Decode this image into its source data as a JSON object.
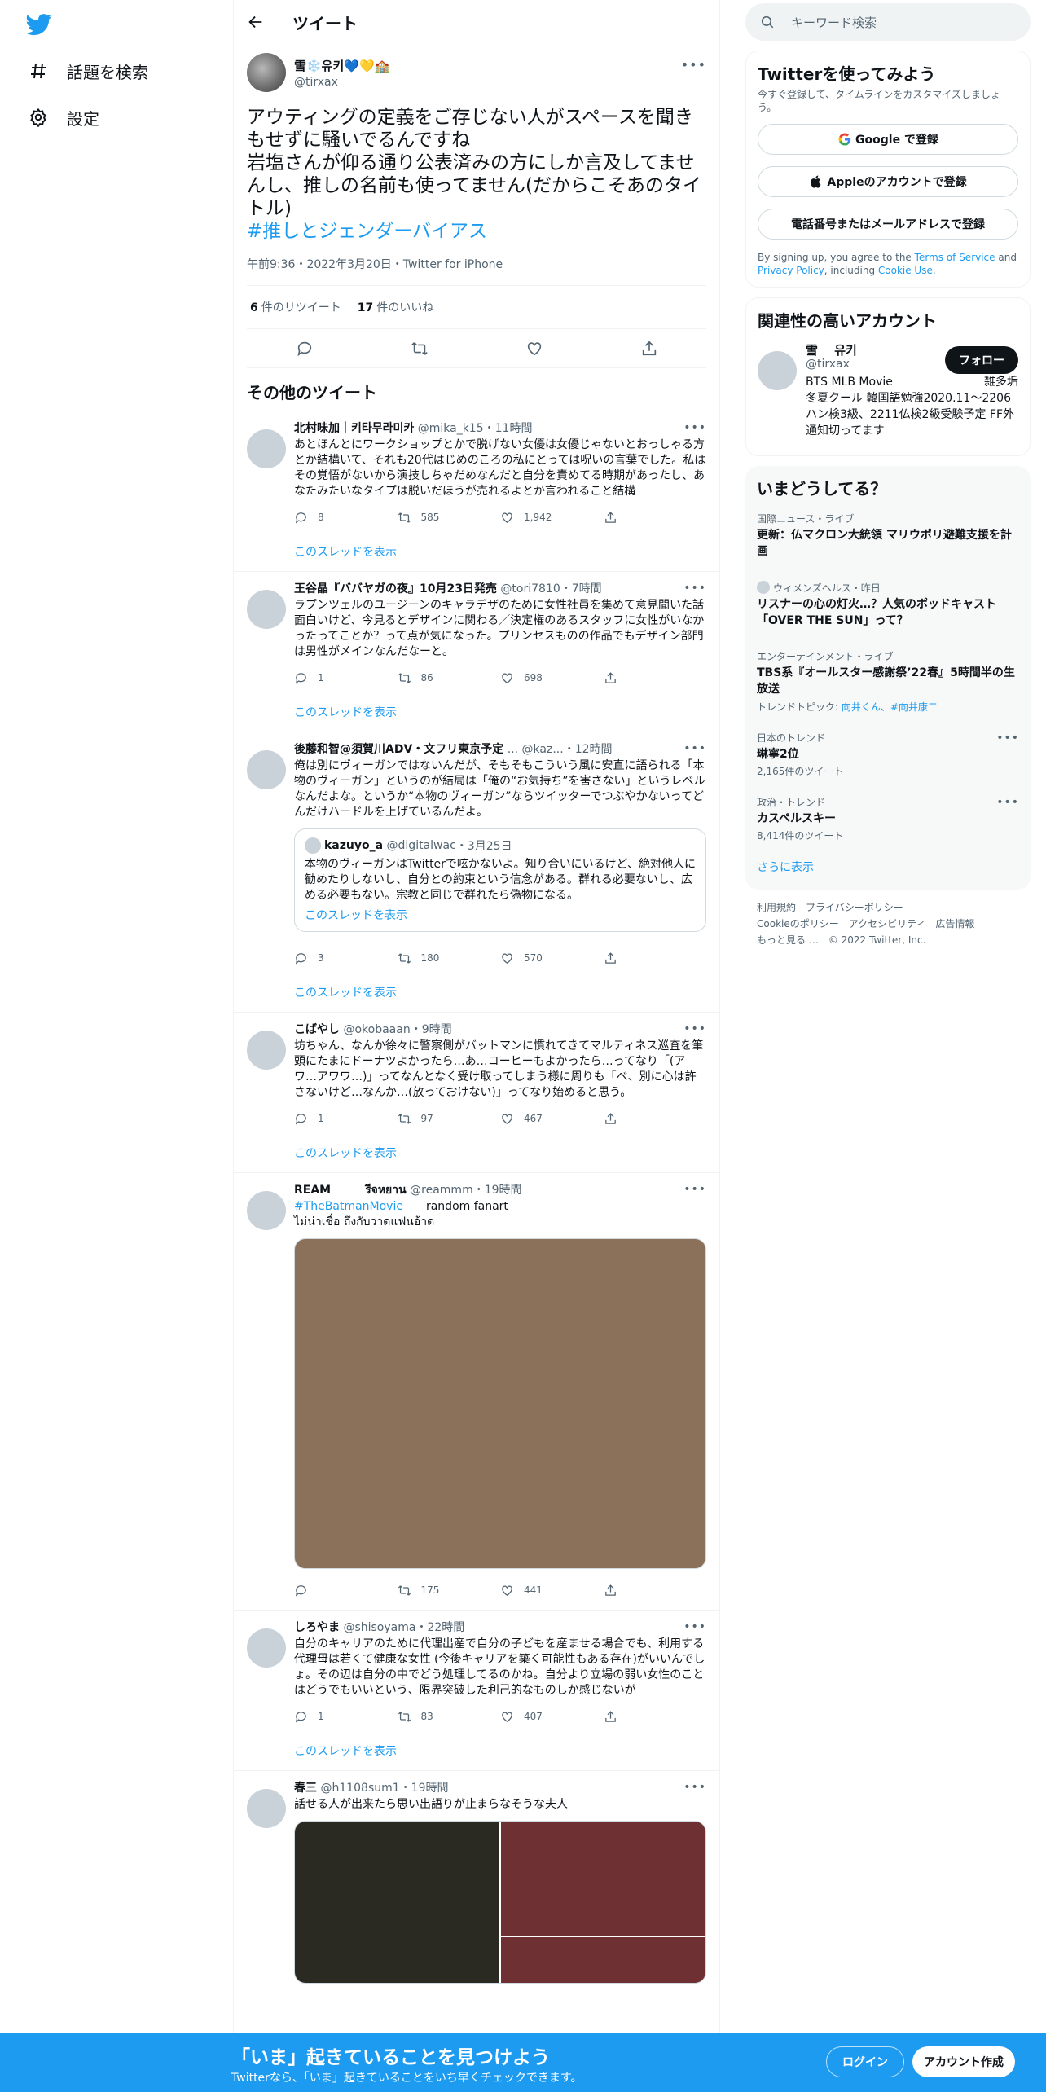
{
  "nav": {
    "explore_label": "話題を検索",
    "settings_label": "設定"
  },
  "header": {
    "title": "ツイート"
  },
  "focal": {
    "name": "雪❄️유키💙💛🏫",
    "handle": "@tirxax",
    "text": "アウティングの定義をご存じない人がスペースを聞きもせずに騒いでるんですね\n岩塩さんが仰る通り公表済みの方にしか言及してませんし、推しの名前も使ってません(だからこそあのタイトル)",
    "hashtag": "#推しとジェンダーバイアス",
    "meta": "午前9:36・2022年3月20日・Twitter for iPhone",
    "retweets": "6",
    "retweets_label": "件のリツイート",
    "likes": "17",
    "likes_label": "件のいいね"
  },
  "section_title": "その他のツイート",
  "show_thread_label": "このスレッドを表示",
  "tweets": [
    {
      "name": "北村味加｜키타무라미카",
      "handle": "@mika_k15",
      "time": "・11時間",
      "text": "あとほんとにワークショップとかで脱げない女優は女優じゃないとおっしゃる方とか結構いて、それも20代はじめのころの私にとっては呪いの言葉でした。私はその覚悟がないから演技しちゃだめなんだと自分を責めてる時期があったし、あなたみたいなタイプは脱いだほうが売れるよとか言われること結構",
      "replies": "8",
      "retweets": "585",
      "likes": "1,942"
    },
    {
      "name": "王谷晶『ババヤガの夜』10月23日発売",
      "handle": "@tori7810",
      "time": "・7時間",
      "text": "ラプンツェルのユージーンのキャラデザのために女性社員を集めて意見聞いた話面白いけど、今見るとデザインに関わる／決定権のあるスタッフに女性がいなかったってことか？って点が気になった。プリンセスものの作品でもデザイン部門は男性がメインなんだなーと。",
      "replies": "1",
      "retweets": "86",
      "likes": "698"
    },
    {
      "name": "後藤和智@須賀川ADV・文フリ東京予定",
      "handle": "... @kaz...",
      "time": "・12時間",
      "text": "俺は別にヴィーガンではないんだが、そもそもこういう風に安直に語られる「本物のヴィーガン」というのが結局は「俺の“お気持ち”を害さない」というレベルなんだよな。というか“本物のヴィーガン”ならツイッターでつぶやかないってどんだけハードルを上げているんだよ。",
      "quote": {
        "name": "kazuyo_a",
        "handle": "@digitalwac",
        "time": "・3月25日",
        "text": "本物のヴィーガンはTwitterで呟かないよ。知り合いにいるけど、絶対他人に勧めたりしないし、自分との約束という信念がある。群れる必要ないし、広める必要もない。宗教と同じで群れたら偽物になる。",
        "link": "このスレッドを表示"
      },
      "replies": "3",
      "retweets": "180",
      "likes": "570"
    },
    {
      "name": "こばやし",
      "handle": "@okobaaan",
      "time": "・9時間",
      "text": "坊ちゃん、なんか徐々に警察側がバットマンに慣れてきてマルティネス巡査を筆頭にたまにドーナツよかったら…あ…コーヒーもよかったら…ってなり「(アワ…アワワ…)」ってなんとなく受け取ってしまう様に周りも「べ、別に心は許さないけど…なんか…(放っておけない)」ってなり始めると思う。",
      "replies": "1",
      "retweets": "97",
      "likes": "467"
    },
    {
      "name": "REAM　　　รีจหยาน",
      "handle": "@reammm",
      "time": "・19時間",
      "hashtag": "#TheBatmanMovie",
      "text": "random fanart\nไม่น่าเชื่อ ถึงกับวาดแฟนอ้าด",
      "replies": "",
      "retweets": "175",
      "likes": "441"
    },
    {
      "name": "しろやま",
      "handle": "@shisoyama",
      "time": "・22時間",
      "text": "自分のキャリアのために代理出産で自分の子どもを産ませる場合でも、利用する代理母は若くて健康な女性 (今後キャリアを築く可能性もある存在)がいいんでしょ。その辺は自分の中でどう処理してるのかね。自分より立場の弱い女性のことはどうでもいいという、限界突破した利己的なものしか感じないが",
      "replies": "1",
      "retweets": "83",
      "likes": "407"
    },
    {
      "name": "春三",
      "handle": "@h1108sum1",
      "time": "・19時間",
      "text": "話せる人が出来たら思い出語りが止まらなそうな夫人"
    }
  ],
  "right": {
    "search_placeholder": "キーワード検索",
    "signup_card": {
      "title": "Twitterを使ってみよう",
      "subtitle": "今すぐ登録して、タイムラインをカスタマイズしましょう。",
      "google": "Google で登録",
      "apple": "Appleのアカウントで登録",
      "phone": "電話番号またはメールアドレスで登録",
      "legal_1": "By signing up, you agree to the",
      "terms": "Terms of Service",
      "and": "and",
      "privacy": "Privacy Policy",
      "including": ", including",
      "cookie": "Cookie Use."
    },
    "related": {
      "title": "関連性の高いアカウント",
      "name": "雪　 유키",
      "handle": "@tirxax",
      "bio": "BTS MLB Movie　　　　　　　　雑多垢 冬夏クール 韓国語勉強2020.11〜2206ハン検3級、2211仏検2級受験予定 FF外通知切ってます",
      "follow": "フォロー"
    },
    "trends": {
      "title": "いまどうしてる？",
      "items": [
        {
          "cat": "国際ニュース・ライブ",
          "title": "更新：仏マクロン大統領 マリウポリ避難支援を計画"
        },
        {
          "cat": "ウィメンズヘルス・昨日",
          "title": "リスナーの心の灯火…？人気のポッドキャスト「OVER THE SUN」って？"
        },
        {
          "cat": "エンターテインメント・ライブ",
          "title": "TBS系『オールスター感謝祭’22春』5時間半の生放送",
          "topics_label": "トレンドトピック: ",
          "topics": "向井くん、#向井康二"
        },
        {
          "cat": "日本のトレンド",
          "title": "琳寧2位",
          "count": "2,165件のツイート"
        },
        {
          "cat": "政治・トレンド",
          "title": "カスペルスキー",
          "count": "8,414件のツイート"
        }
      ],
      "show_more": "さらに表示"
    },
    "footer": {
      "links": [
        "利用規約",
        "プライバシーポリシー",
        "Cookieのポリシー",
        "アクセシビリティ",
        "広告情報",
        "もっと見る …",
        "© 2022 Twitter, Inc."
      ]
    }
  },
  "bottom_bar": {
    "title": "「いま」起きていることを見つけよう",
    "subtitle": "Twitterなら、「いま」起きていることをいち早くチェックできます。",
    "login": "ログイン",
    "signup": "アカウント作成"
  },
  "colors": {
    "accent": "#1d9bf0",
    "text": "#0f1419",
    "muted": "#536471"
  }
}
